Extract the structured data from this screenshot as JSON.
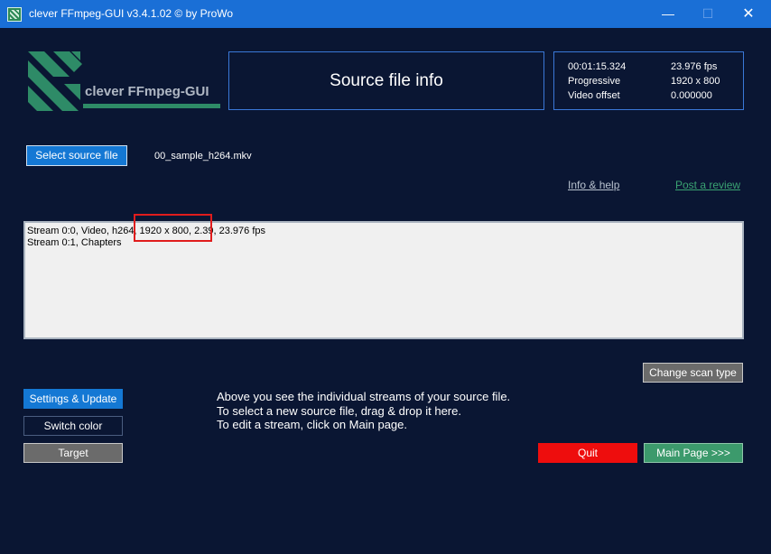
{
  "window": {
    "title": "clever FFmpeg-GUI v3.4.1.02   © by ProWo",
    "minimize_glyph": "—",
    "maximize_glyph": "☐",
    "close_glyph": "✕"
  },
  "logo": {
    "text": "clever FFmpeg-GUI"
  },
  "header": {
    "source_info_title": "Source file info"
  },
  "info": {
    "duration": "00:01:15.324",
    "fps": "23.976 fps",
    "scan": "Progressive",
    "resolution": "1920 x 800",
    "offset_label": "Video offset",
    "offset_value": "0.000000"
  },
  "source": {
    "select_label": "Select source file",
    "filename": "00_sample_h264.mkv"
  },
  "links": {
    "info_help": "Info & help",
    "post_review": "Post a review"
  },
  "streams": [
    "Stream 0:0, Video, h264, 1920 x 800, 2.39, 23.976 fps",
    "Stream 0:1, Chapters"
  ],
  "buttons": {
    "change_scan": "Change scan type",
    "settings": "Settings & Update",
    "switch_color": "Switch color",
    "target": "Target",
    "quit": "Quit",
    "main_page": "Main Page >>>"
  },
  "instructions": [
    "Above you see the individual streams of your source file.",
    "To select a new source file, drag & drop it here.",
    "To edit a stream, click on Main page."
  ],
  "colors": {
    "background": "#0a1633",
    "titlebar": "#1a6fd6",
    "accent_blue": "#1478d4",
    "quit_red": "#ee0d0d",
    "main_green": "#3c9a6c",
    "logo_green": "#2e8b67"
  }
}
